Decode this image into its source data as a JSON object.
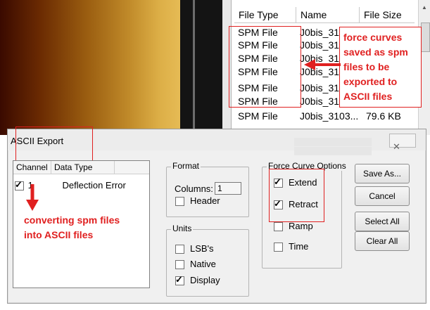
{
  "filelist": {
    "headers": [
      "File Type",
      "Name",
      "File Size"
    ],
    "rows": [
      {
        "type": "SPM File",
        "name": "J0bis_310",
        "size": ""
      },
      {
        "type": "SPM File",
        "name": "J0bis_310",
        "size": ""
      },
      {
        "type": "SPM File",
        "name": "J0bis_310",
        "size": ""
      },
      {
        "type": "SPM File",
        "name": "J0bis_310",
        "size": ""
      },
      {
        "type": "SPM File",
        "name": "J0bis_310",
        "size": ""
      },
      {
        "type": "SPM File",
        "name": "J0bis_310",
        "size": ""
      },
      {
        "type": "SPM File",
        "name": "J0bis_3103...",
        "size": "79.6 KB"
      }
    ]
  },
  "annotations": {
    "file_note": [
      "force curves",
      "saved as spm",
      "files to be",
      "exported to",
      "ASCII files"
    ],
    "channel_note": [
      "converting spm files",
      "into ASCII files"
    ]
  },
  "dialog": {
    "title": "ASCII Export",
    "close_glyph": "✕",
    "channel_table": {
      "headers": [
        "Channel",
        "Data Type"
      ],
      "rows": [
        {
          "checked": true,
          "channel": "1",
          "data_type": "Deflection Error"
        }
      ]
    },
    "format": {
      "title": "Format",
      "columns_label": "Columns:",
      "columns_value": "1",
      "header": {
        "label": "Header",
        "checked": false
      }
    },
    "units": {
      "title": "Units",
      "options": [
        {
          "label": "LSB's",
          "checked": false
        },
        {
          "label": "Native",
          "checked": false
        },
        {
          "label": "Display",
          "checked": true
        }
      ]
    },
    "force_curve_options": {
      "title": "Force Curve Options",
      "options": [
        {
          "label": "Extend",
          "checked": true
        },
        {
          "label": "Retract",
          "checked": true
        },
        {
          "label": "Ramp",
          "checked": false
        },
        {
          "label": "Time",
          "checked": false
        }
      ]
    },
    "buttons": {
      "save_as": "Save As...",
      "cancel": "Cancel",
      "select_all": "Select All",
      "clear_all": "Clear All"
    }
  },
  "colors": {
    "annotation": "#e02020",
    "dialog_bg": "#f0f0f0"
  }
}
